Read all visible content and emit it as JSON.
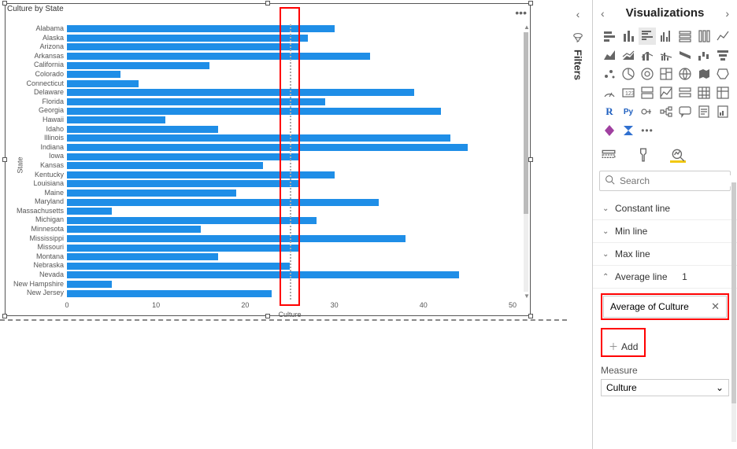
{
  "chart": {
    "title": "Culture by State",
    "y_axis_label": "State",
    "x_axis_label": "Culture"
  },
  "chart_data": {
    "type": "bar",
    "orientation": "horizontal",
    "xlabel": "Culture",
    "ylabel": "State",
    "title": "Culture by State",
    "xlim": [
      0,
      50
    ],
    "x_ticks": [
      0,
      10,
      20,
      30,
      40,
      50
    ],
    "average_line": 25,
    "categories": [
      "Alabama",
      "Alaska",
      "Arizona",
      "Arkansas",
      "California",
      "Colorado",
      "Connecticut",
      "Delaware",
      "Florida",
      "Georgia",
      "Hawaii",
      "Idaho",
      "Illinois",
      "Indiana",
      "Iowa",
      "Kansas",
      "Kentucky",
      "Louisiana",
      "Maine",
      "Maryland",
      "Massachusetts",
      "Michigan",
      "Minnesota",
      "Mississippi",
      "Missouri",
      "Montana",
      "Nebraska",
      "Nevada",
      "New Hampshire",
      "New Jersey"
    ],
    "values": [
      30,
      27,
      26,
      34,
      16,
      6,
      8,
      39,
      29,
      42,
      11,
      17,
      43,
      45,
      26,
      22,
      30,
      26,
      19,
      35,
      5,
      28,
      15,
      38,
      26,
      17,
      25,
      44,
      5,
      23
    ]
  },
  "filters_rail": {
    "label": "Filters"
  },
  "viz_pane": {
    "title": "Visualizations",
    "search_placeholder": "Search",
    "sections": {
      "constant": "Constant line",
      "min": "Min line",
      "max": "Max line",
      "average": "Average line",
      "average_count": "1"
    },
    "avg_measure": "Average of Culture",
    "add_label": "Add",
    "measure_label": "Measure",
    "measure_value": "Culture"
  }
}
